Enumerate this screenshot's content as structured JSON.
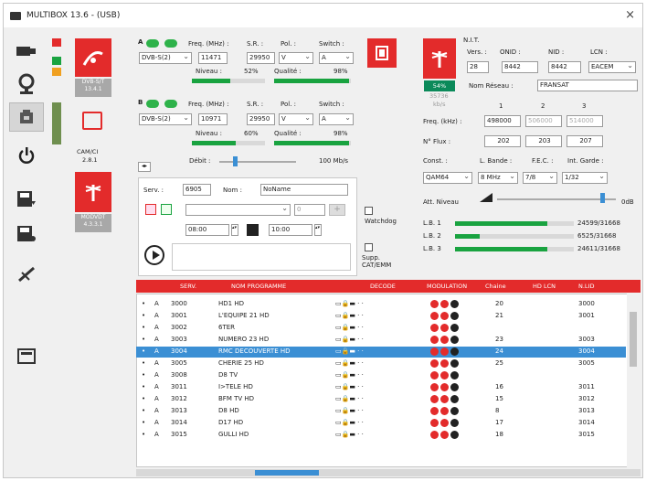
{
  "window": {
    "title": "MULTIBOX 13.6 - (USB)",
    "close": "×"
  },
  "toolbar": {
    "icons": [
      "usb-icon",
      "location-icon",
      "device-icon",
      "power-icon",
      "save-down-icon",
      "save-icon",
      "antenna-tools-icon",
      "display-icon"
    ]
  },
  "devices": [
    {
      "name": "DVB-S/T 13.4.1"
    },
    {
      "name": "CAM/CI",
      "version": "2.8.1"
    },
    {
      "name": "MODVDT 4.3.3.1"
    }
  ],
  "tuner_a": {
    "label": "A",
    "freq_label": "Freq. (MHz) :",
    "sr_label": "S.R. :",
    "pol_label": "Pol. :",
    "switch_label": "Switch :",
    "std": "DVB-S(2)",
    "freq": "11471",
    "sr": "29950",
    "pol": "V",
    "switch": "A",
    "level_label": "Niveau :",
    "level": "52%",
    "quality_label": "Qualité :",
    "quality": "98%",
    "level_pct": 52,
    "quality_pct": 98
  },
  "tuner_b": {
    "label": "B",
    "freq_label": "Freq. (MHz) :",
    "sr_label": "S.R. :",
    "pol_label": "Pol. :",
    "switch_label": "Switch :",
    "std": "DVB-S(2)",
    "freq": "10971",
    "sr": "29950",
    "pol": "V",
    "switch": "A",
    "level_label": "Niveau :",
    "level": "60%",
    "quality_label": "Qualité :",
    "quality": "98%",
    "level_pct": 60,
    "quality_pct": 98
  },
  "debit": {
    "label": "Débit :",
    "value": "100 Mb/s"
  },
  "service": {
    "serv_label": "Serv. :",
    "serv_value": "6905",
    "nom_label": "Nom :",
    "nom_value": "NoName",
    "spin_value": "0",
    "time_start": "08:00",
    "time_end": "10:00"
  },
  "options": {
    "watchdog": "Watchdog",
    "supp_cat": "Supp. CAT/EMM"
  },
  "nit": {
    "title": "N.I.T.",
    "vers_label": "Vers. :",
    "onid_label": "ONID :",
    "nid_label": "NID :",
    "lcn_label": "LCN :",
    "vers": "28",
    "onid": "8442",
    "nid": "8442",
    "lcn": "EACEM",
    "nom_reseau_label": "Nom Réseau :",
    "nom_reseau": "FRANSAT",
    "rssi_pct": "54%",
    "rssi_val": "35736",
    "rssi_unit": "kb/s",
    "cols": [
      "1",
      "2",
      "3"
    ],
    "freq_label": "Freq. (kHz) :",
    "freqs": [
      "498000",
      "506000",
      "514000"
    ],
    "nflux_label": "N° Flux :",
    "nflux": [
      "202",
      "203",
      "207"
    ],
    "const_label": "Const. :",
    "const": "QAM64",
    "lbande_label": "L. Bande :",
    "lbande": "8 MHz",
    "fec_label": "F.E.C. :",
    "fec": "7/8",
    "garde_label": "Int. Garde :",
    "garde": "1/32",
    "att_label": "Att. Niveau",
    "att_value": "0dB",
    "lb": [
      {
        "label": "L.B. 1",
        "value": "24599/31668",
        "pct": 78
      },
      {
        "label": "L.B. 2",
        "value": "6525/31668",
        "pct": 21
      },
      {
        "label": "L.B. 3",
        "value": "24611/31668",
        "pct": 78
      }
    ]
  },
  "table": {
    "headers": [
      "SERV.",
      "NOM PROGRAMME",
      "DECODE",
      "MODULATION",
      "Chaine",
      "HD LCN",
      "N.LID"
    ],
    "rows": [
      {
        "src": "A",
        "serv": "3000",
        "name": "HD1 HD",
        "chaine": "20",
        "lid": "3000"
      },
      {
        "src": "A",
        "serv": "3001",
        "name": "L'EQUIPE 21 HD",
        "chaine": "21",
        "lid": "3001"
      },
      {
        "src": "A",
        "serv": "3002",
        "name": "6TER",
        "chaine": "",
        "lid": ""
      },
      {
        "src": "A",
        "serv": "3003",
        "name": "NUMERO 23 HD",
        "chaine": "23",
        "lid": "3003"
      },
      {
        "src": "A",
        "serv": "3004",
        "name": "RMC DECOUVERTE HD",
        "chaine": "24",
        "lid": "3004"
      },
      {
        "src": "A",
        "serv": "3005",
        "name": "CHERIE 25 HD",
        "chaine": "25",
        "lid": "3005"
      },
      {
        "src": "A",
        "serv": "3008",
        "name": "D8 TV",
        "chaine": "",
        "lid": ""
      },
      {
        "src": "A",
        "serv": "3011",
        "name": "I>TELE HD",
        "chaine": "16",
        "lid": "3011"
      },
      {
        "src": "A",
        "serv": "3012",
        "name": "BFM TV HD",
        "chaine": "15",
        "lid": "3012"
      },
      {
        "src": "A",
        "serv": "3013",
        "name": "D8 HD",
        "chaine": "8",
        "lid": "3013"
      },
      {
        "src": "A",
        "serv": "3014",
        "name": "D17 HD",
        "chaine": "17",
        "lid": "3014"
      },
      {
        "src": "A",
        "serv": "3015",
        "name": "GULLI HD",
        "chaine": "18",
        "lid": "3015"
      }
    ]
  },
  "colors": {
    "red": "#e32b2b",
    "green": "#19a340",
    "blue": "#3b8fd4"
  }
}
